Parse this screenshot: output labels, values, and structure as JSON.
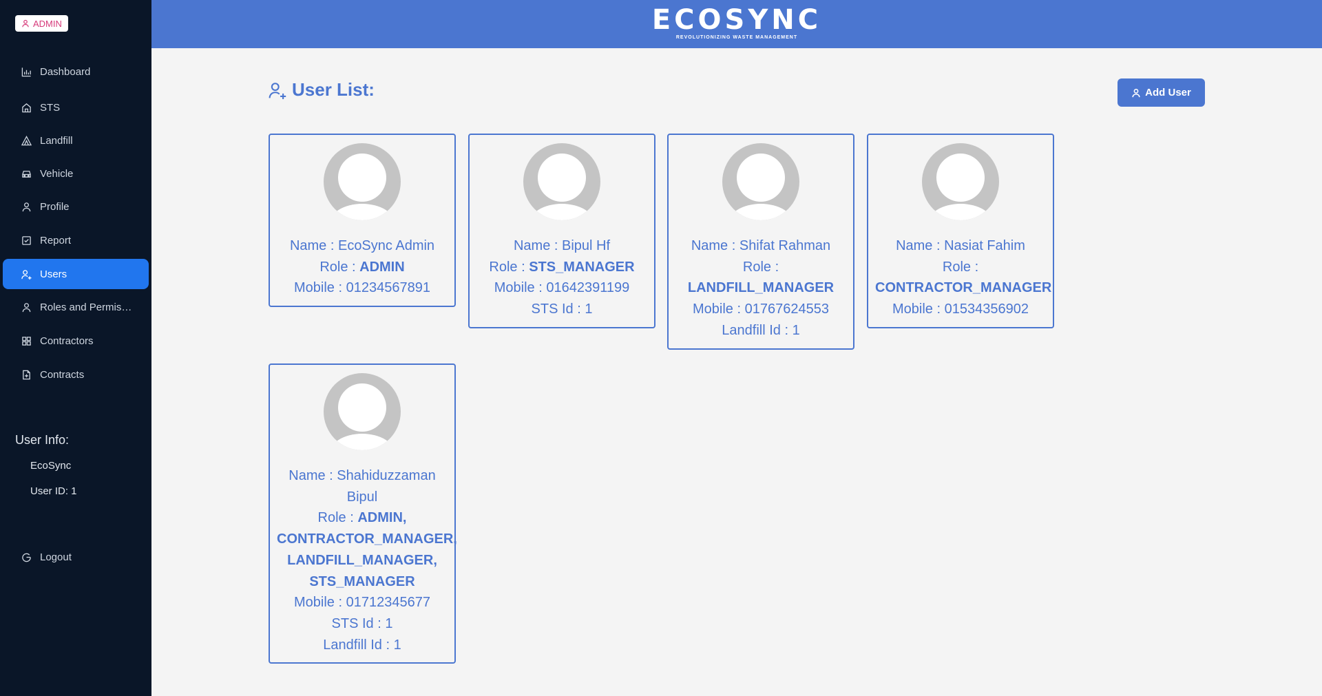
{
  "sidebar": {
    "badge": "ADMIN",
    "items": [
      {
        "label": "Dashboard",
        "icon": "chart-icon"
      },
      {
        "label": "STS",
        "icon": "home-icon"
      },
      {
        "label": "Landfill",
        "icon": "landfill-icon"
      },
      {
        "label": "Vehicle",
        "icon": "vehicle-icon"
      },
      {
        "label": "Profile",
        "icon": "user-icon"
      },
      {
        "label": "Report",
        "icon": "report-icon"
      },
      {
        "label": "Users",
        "icon": "users-icon",
        "active": true
      },
      {
        "label": "Roles and Permissions",
        "icon": "user-icon"
      },
      {
        "label": "Contractors",
        "icon": "grid-icon"
      },
      {
        "label": "Contracts",
        "icon": "file-icon"
      }
    ],
    "user_info_title": "User Info:",
    "user_name": "EcoSync",
    "user_id": "User ID: 1",
    "logout": "Logout"
  },
  "header": {
    "logo": "ECOSYNC",
    "tagline": "REVOLUTIONIZING WASTE MANAGEMENT"
  },
  "main": {
    "title": "User List:",
    "add_button": "Add User",
    "users": [
      {
        "name": "Name : EcoSync Admin",
        "role_label": "Role : ",
        "role": "ADMIN",
        "mobile": "Mobile : 01234567891"
      },
      {
        "name": "Name : Bipul Hf",
        "role_label": "Role : ",
        "role": "STS_MANAGER",
        "mobile": "Mobile : 01642391199",
        "sts": "STS Id : 1"
      },
      {
        "name": "Name : Shifat Rahman",
        "role_label": "Role : ",
        "role": "LANDFILL_MANAGER",
        "mobile": "Mobile : 01767624553",
        "landfill": "Landfill Id : 1"
      },
      {
        "name": "Name : Nasiat Fahim",
        "role_label": "Role : ",
        "role": "CONTRACTOR_MANAGER",
        "mobile": "Mobile : 01534356902"
      },
      {
        "name": "Name : Shahiduzzaman Bipul",
        "role_label": "Role : ",
        "role": "ADMIN, CONTRACTOR_MANAGER, LANDFILL_MANAGER, STS_MANAGER",
        "mobile": "Mobile : 01712345677",
        "sts": "STS Id : 1",
        "landfill": "Landfill Id : 1"
      }
    ]
  },
  "colors": {
    "sidebar_bg": "#0a1628",
    "header_bg": "#4b76d0",
    "accent": "#4b76d0",
    "active_nav": "#2176ee",
    "badge_text": "#d63a7a"
  }
}
